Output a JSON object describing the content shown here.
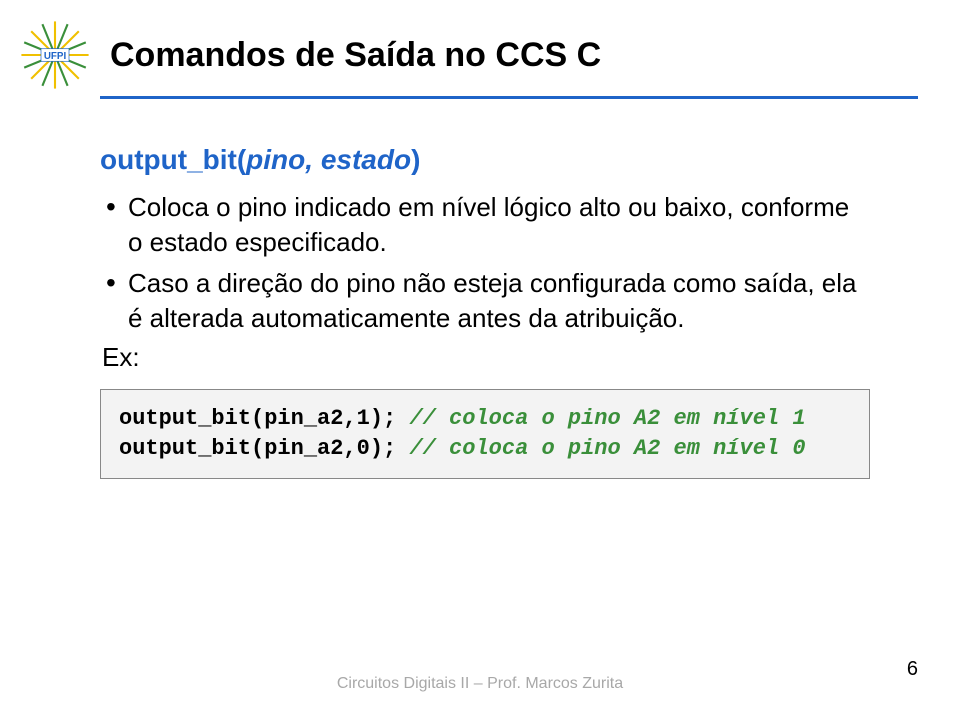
{
  "header": {
    "logo_alt": "UFPI",
    "title": "Comandos de Saída no CCS C"
  },
  "content": {
    "func_name": "output_bit(",
    "func_args": "pino, estado",
    "func_close": ")",
    "bullets": [
      "Coloca o pino indicado em nível lógico alto ou baixo, conforme o estado especificado.",
      "Caso a direção do pino não esteja configurada como saída, ela é alterada automaticamente antes da atribuição."
    ],
    "ex_label": "Ex:",
    "code": {
      "line1_code": "output_bit(pin_a2,1); ",
      "line1_comment": "// coloca o pino A2 em nível 1",
      "line2_code": "output_bit(pin_a2,0); ",
      "line2_comment": "// coloca o pino A2 em nível 0"
    }
  },
  "footer": {
    "text": "Circuitos Digitais II – Prof. Marcos Zurita",
    "page": "6"
  }
}
